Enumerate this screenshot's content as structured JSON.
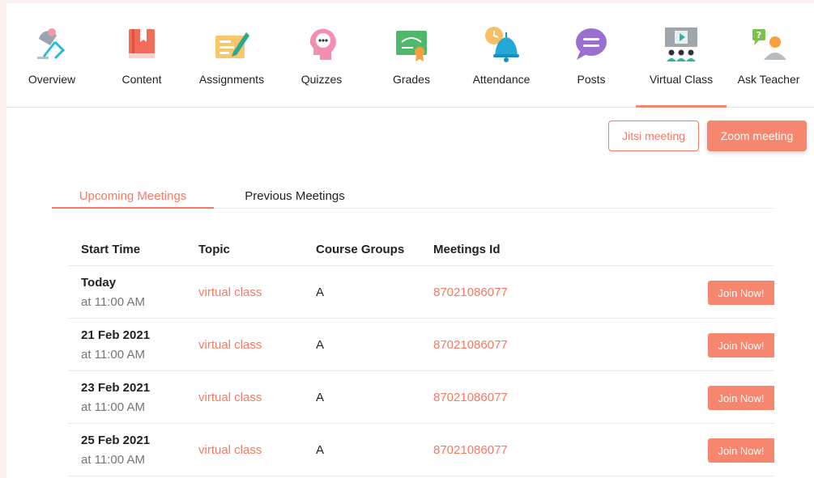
{
  "nav": {
    "items": [
      {
        "label": "Overview",
        "icon": "overview-lamp-icon"
      },
      {
        "label": "Content",
        "icon": "book-icon"
      },
      {
        "label": "Assignments",
        "icon": "pen-paper-icon"
      },
      {
        "label": "Quizzes",
        "icon": "head-thought-icon"
      },
      {
        "label": "Grades",
        "icon": "certificate-icon"
      },
      {
        "label": "Attendance",
        "icon": "bell-clock-icon"
      },
      {
        "label": "Posts",
        "icon": "chat-bubble-icon"
      },
      {
        "label": "Virtual Class",
        "icon": "presentation-screen-icon"
      },
      {
        "label": "Ask Teacher",
        "icon": "question-user-icon"
      }
    ],
    "active": "Virtual Class"
  },
  "actions": {
    "jitsi_label": "Jitsi meeting",
    "zoom_label": "Zoom meeting"
  },
  "tabs": {
    "upcoming": "Upcoming Meetings",
    "previous": "Previous Meetings"
  },
  "table": {
    "headers": {
      "start_time": "Start Time",
      "topic": "Topic",
      "course_groups": "Course Groups",
      "meetings_id": "Meetings Id"
    },
    "rows": [
      {
        "date": "Today",
        "time": "at 11:00 AM",
        "topic": "virtual class",
        "group": "A",
        "meeting_id": "87021086077",
        "action": "Join Now!"
      },
      {
        "date": "21 Feb 2021",
        "time": "at 11:00 AM",
        "topic": "virtual class",
        "group": "A",
        "meeting_id": "87021086077",
        "action": "Join Now!"
      },
      {
        "date": "23 Feb 2021",
        "time": "at 11:00 AM",
        "topic": "virtual class",
        "group": "A",
        "meeting_id": "87021086077",
        "action": "Join Now!"
      },
      {
        "date": "25 Feb 2021",
        "time": "at 11:00 AM",
        "topic": "virtual class",
        "group": "A",
        "meeting_id": "87021086077",
        "action": "Join Now!"
      }
    ]
  },
  "colors": {
    "accent": "#f47a62",
    "button_fill": "#f7866e",
    "text": "#222222",
    "muted": "#757575"
  }
}
